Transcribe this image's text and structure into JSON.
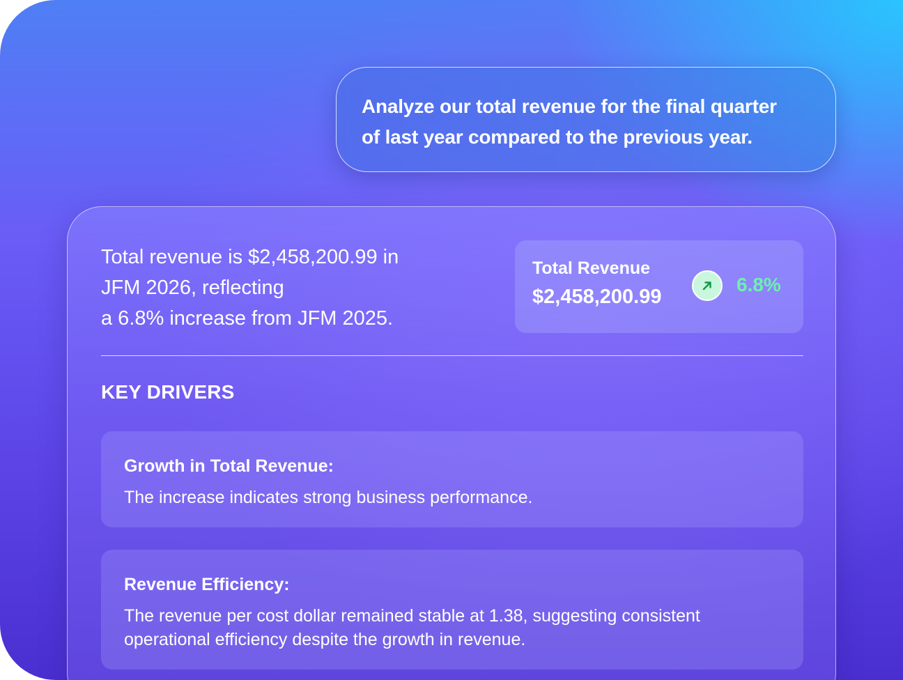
{
  "prompt": {
    "text": "Analyze our total revenue  for the final quarter\nof last year compared to the previous year."
  },
  "response": {
    "summary": "Total revenue is $2,458,200.99 in\nJFM 2026, reflecting\na 6.8% increase from JFM 2025.",
    "metric": {
      "label": "Total Revenue",
      "value": "$2,458,200.99",
      "change": "6.8%",
      "trend_icon": "arrow-up-right-icon",
      "trend_color": "#6ef0b0"
    },
    "key_drivers": {
      "heading": "KEY DRIVERS",
      "items": [
        {
          "title": "Growth in Total Revenue:",
          "body": "The increase  indicates strong business performance."
        },
        {
          "title": "Revenue Efficiency:",
          "body": "The revenue per cost dollar remained stable at 1.38, suggesting consistent\noperational efficiency despite the growth in revenue."
        }
      ]
    }
  }
}
